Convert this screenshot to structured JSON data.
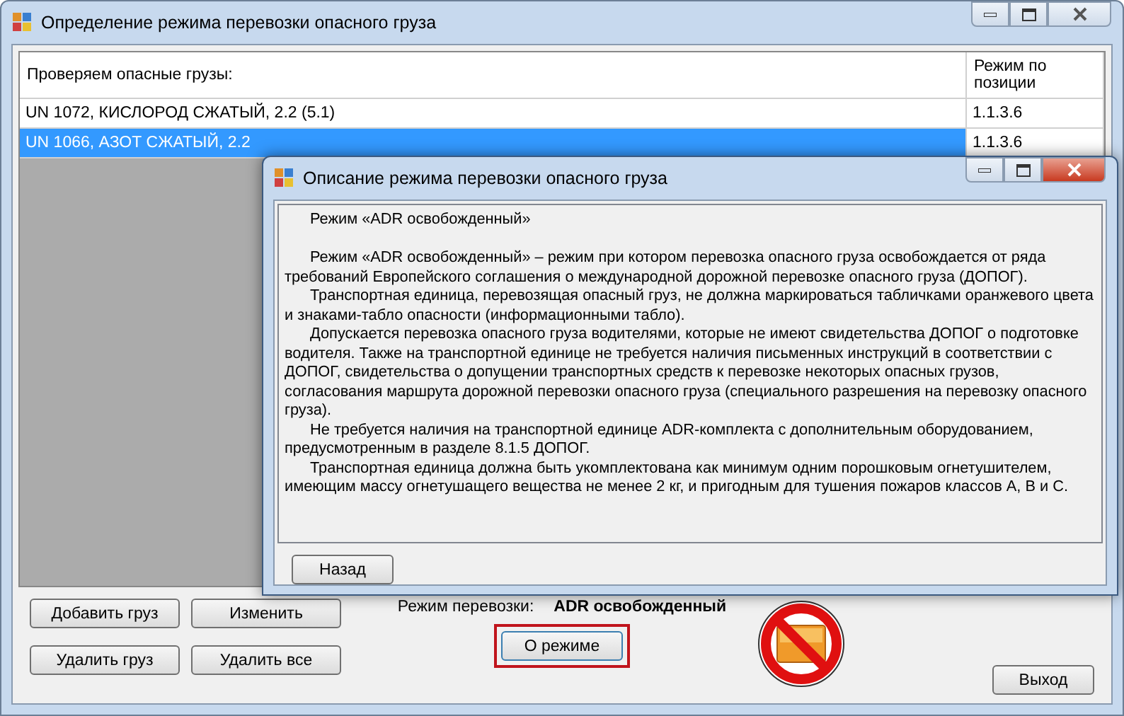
{
  "window": {
    "title": "Определение режима перевозки опасного груза"
  },
  "grid": {
    "columns": [
      "Проверяем опасные грузы:",
      "Режим по позиции"
    ],
    "rows": [
      {
        "cells": [
          "UN 1072, КИСЛОРОД СЖАТЫЙ, 2.2 (5.1)",
          "1.1.3.6"
        ],
        "selected": false
      },
      {
        "cells": [
          "UN 1066, АЗОТ СЖАТЫЙ, 2.2",
          "1.1.3.6"
        ],
        "selected": true
      }
    ]
  },
  "dialog": {
    "title": "Описание режима перевозки опасного груза",
    "paragraphs": [
      {
        "kind": "heading",
        "text": "Режим «ADR освобожденный»"
      },
      {
        "kind": "body",
        "text": "Режим «ADR освобожденный» –  режим при котором перевозка опасного груза освобождается от ряда требований Европейского соглашения о международной дорожной перевозке опасного груза (ДОПОГ)."
      },
      {
        "kind": "body",
        "text": "Транспортная единица, перевозящая опасный груз, не должна маркироваться табличками оранжевого цвета и знаками-табло опасности (информационными табло)."
      },
      {
        "kind": "body",
        "text": "Допускается перевозка опасного груза водителями, которые не имеют свидетельства ДОПОГ о подготовке водителя. Также на транспортной единице не требуется наличия письменных инструкций в соответствии с ДОПОГ, свидетельства о допущении транспортных средств к перевозке некоторых опасных грузов, согласования маршрута дорожной перевозки опасного груза (специального разрешения на перевозку опасного груза)."
      },
      {
        "kind": "body",
        "text": "Не требуется наличия на транспортной единице ADR-комплекта с дополнительным оборудованием, предусмотренным в разделе 8.1.5 ДОПОГ."
      },
      {
        "kind": "body",
        "text": "Транспортная единица должна быть укомплектована как минимум одним порошковым огнетушителем, имеющим массу огнетушащего вещества не менее 2 кг, и пригодным для тушения пожаров классов А, В и С."
      }
    ],
    "button": "Назад"
  },
  "actions": [
    "Добавить груз",
    "Изменить",
    "Удалить груз",
    "Удалить все"
  ],
  "mode": {
    "label": "Режим перевозки:",
    "value": "ADR освобожденный",
    "button": {
      "label": "О режиме",
      "highlighted": true
    }
  },
  "exit": "Выход"
}
